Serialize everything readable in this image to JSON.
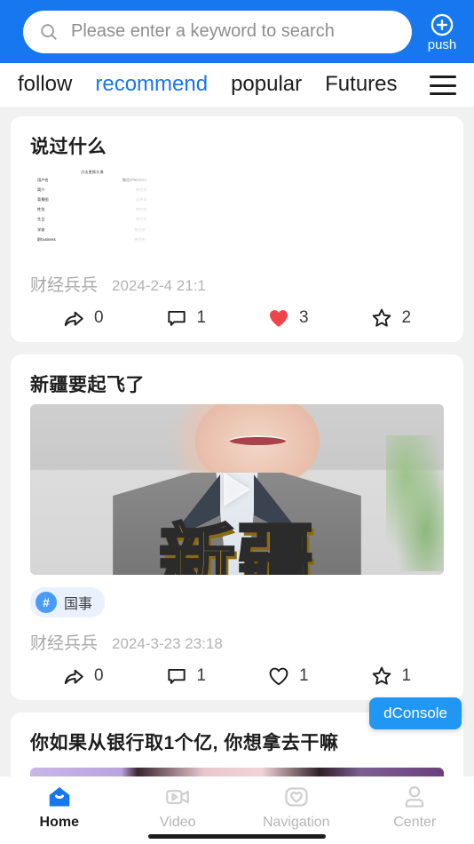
{
  "header": {
    "search": {
      "placeholder": "Please enter a keyword to search",
      "value": "",
      "icon": "search-icon"
    },
    "push": {
      "label": "push",
      "icon": "plus-circle-icon"
    },
    "brand_color": "#1677ef"
  },
  "tabs": {
    "items": [
      {
        "label": "follow",
        "active": false
      },
      {
        "label": "recommend",
        "active": true
      },
      {
        "label": "popular",
        "active": false
      },
      {
        "label": "Futures",
        "active": false
      }
    ],
    "menu_icon": "hamburger-menu-icon",
    "active_color": "#1677ef"
  },
  "feed": {
    "cards": [
      {
        "title": "说过什么",
        "media_type": "image",
        "embedded_form": {
          "heading": "点击更换头像",
          "rows": [
            {
              "label": "用户名",
              "value": "微信37552N03",
              "muted": false
            },
            {
              "label": "简介",
              "value": "待完善",
              "muted": true
            },
            {
              "label": "背景图",
              "value": "去更换",
              "muted": true
            },
            {
              "label": "性别",
              "value": "待完善",
              "muted": true
            },
            {
              "label": "生日",
              "value": "待完善",
              "muted": true
            },
            {
              "label": "学校",
              "value": "待完善*",
              "muted": true
            },
            {
              "label": "职business",
              "value": "待完善*",
              "muted": true
            }
          ]
        },
        "tag": null,
        "author": "财经兵兵",
        "date": "2024-2-4 21:1",
        "actions": [
          {
            "icon": "share-icon",
            "count": "0",
            "state": "off"
          },
          {
            "icon": "comment-icon",
            "count": "1",
            "state": "off"
          },
          {
            "icon": "heart-icon",
            "count": "3",
            "state": "on"
          },
          {
            "icon": "star-icon",
            "count": "2",
            "state": "off"
          }
        ]
      },
      {
        "title": "新疆要起飞了",
        "media_type": "video",
        "video_overlay_text": "新疆",
        "play_icon": "play-icon",
        "tag": {
          "hash": "#",
          "text": "国事"
        },
        "author": "财经兵兵",
        "date": "2024-3-23 23:18",
        "actions": [
          {
            "icon": "share-icon",
            "count": "0",
            "state": "off"
          },
          {
            "icon": "comment-icon",
            "count": "1",
            "state": "off"
          },
          {
            "icon": "heart-icon",
            "count": "1",
            "state": "off"
          },
          {
            "icon": "star-icon",
            "count": "1",
            "state": "off"
          }
        ]
      },
      {
        "title": "你如果从银行取1个亿, 你想拿去干嘛",
        "media_type": "image"
      }
    ]
  },
  "dconsole": {
    "label": "dConsole",
    "color": "#2196f3"
  },
  "bottomnav": {
    "items": [
      {
        "label": "Home",
        "icon": "home-icon",
        "active": true
      },
      {
        "label": "Video",
        "icon": "video-camera-icon",
        "active": false
      },
      {
        "label": "Navigation",
        "icon": "heart-square-icon",
        "active": false
      },
      {
        "label": "Center",
        "icon": "user-icon",
        "active": false
      }
    ]
  }
}
